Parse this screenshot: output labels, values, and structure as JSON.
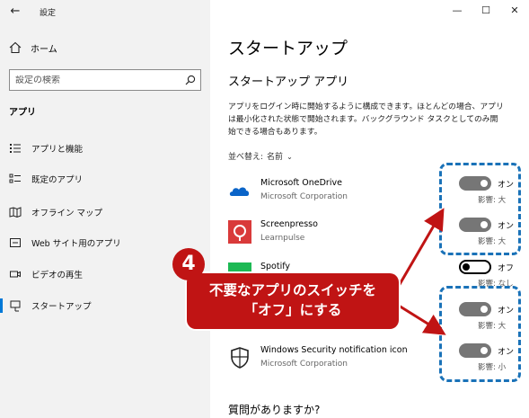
{
  "window": {
    "title": "設定",
    "back_icon": "back-arrow-icon",
    "controls": [
      "—",
      "☐",
      "✕"
    ]
  },
  "sidebar": {
    "home_label": "ホーム",
    "search_placeholder": "設定の検索",
    "section_label": "アプリ",
    "items": [
      {
        "label": "アプリと機能",
        "icon": "apps-list-icon"
      },
      {
        "label": "既定のアプリ",
        "icon": "default-apps-icon"
      },
      {
        "label": "オフライン マップ",
        "icon": "offline-map-icon"
      },
      {
        "label": "Web サイト用のアプリ",
        "icon": "web-apps-icon"
      },
      {
        "label": "ビデオの再生",
        "icon": "video-icon"
      },
      {
        "label": "スタートアップ",
        "icon": "startup-icon",
        "active": true
      }
    ]
  },
  "main": {
    "page_title": "スタートアップ",
    "sub_title": "スタートアップ アプリ",
    "description": [
      "アプリをログイン時に開始するように構成できます。ほとんどの場合、アプリ",
      "は最小化された状態で開始されます。バックグラウンド タスクとしてのみ開",
      "始できる場合もあります。"
    ],
    "sort_label": "並べ替え:",
    "sort_value": "名前",
    "apps": [
      {
        "name": "Microsoft OneDrive",
        "publisher": "Microsoft Corporation",
        "state": "オン",
        "on": true,
        "impact": "影響: 大",
        "icon": "onedrive-icon"
      },
      {
        "name": "Screenpresso",
        "publisher": "Learnpulse",
        "state": "オン",
        "on": true,
        "impact": "影響: 大",
        "icon": "screenpresso-icon"
      },
      {
        "name": "Spotify",
        "publisher": "",
        "state": "オフ",
        "on": false,
        "impact": "影響: なし",
        "icon": "spotify-icon"
      },
      {
        "name": "",
        "publisher": "",
        "state": "オン",
        "on": true,
        "impact": "影響: 大",
        "icon": ""
      },
      {
        "name": "Windows Security notification icon",
        "publisher": "Microsoft Corporation",
        "state": "オン",
        "on": true,
        "impact": "影響: 小",
        "icon": "windows-security-icon"
      }
    ],
    "question": "質問がありますか?"
  },
  "annotation": {
    "step": "4",
    "callout_line1": "不要なアプリのスイッチを",
    "callout_line2": "「オフ」にする",
    "accent_red": "#c01414",
    "dash_blue": "#1a72b8"
  }
}
